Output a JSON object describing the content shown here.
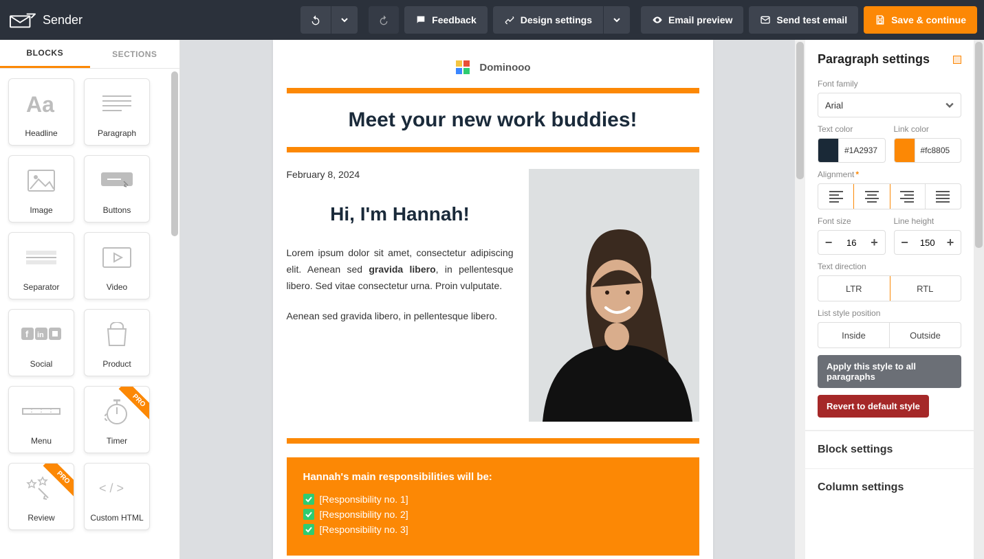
{
  "app": {
    "name": "Sender"
  },
  "topbar": {
    "feedback": "Feedback",
    "design_settings": "Design settings",
    "email_preview": "Email preview",
    "send_test": "Send test email",
    "save": "Save & continue"
  },
  "sidebar_tabs": {
    "blocks": "BLOCKS",
    "sections": "SECTIONS"
  },
  "blocks": [
    {
      "label": "Headline",
      "icon": "headline"
    },
    {
      "label": "Paragraph",
      "icon": "paragraph"
    },
    {
      "label": "Image",
      "icon": "image"
    },
    {
      "label": "Buttons",
      "icon": "buttons"
    },
    {
      "label": "Separator",
      "icon": "separator"
    },
    {
      "label": "Video",
      "icon": "video"
    },
    {
      "label": "Social",
      "icon": "social"
    },
    {
      "label": "Product",
      "icon": "product"
    },
    {
      "label": "Menu",
      "icon": "menu"
    },
    {
      "label": "Timer",
      "icon": "timer",
      "pro": true
    },
    {
      "label": "Review",
      "icon": "review",
      "pro": true
    },
    {
      "label": "Custom HTML",
      "icon": "html"
    }
  ],
  "email": {
    "brand": "Dominooo",
    "title": "Meet your new work buddies!",
    "date": "February 8, 2024",
    "greeting": "Hi, I'm Hannah!",
    "p1a": "Lorem ipsum dolor sit amet, consectetur adipiscing elit. Aenean sed ",
    "p1b": "gravida libero",
    "p1c": ", in pellentesque libero. Sed vitae consectetur urna. Proin vulputate.",
    "p2": "Aenean sed gravida libero, in pellentesque libero.",
    "resp_title": "Hannah's main responsibilities will be:",
    "responsibilities": [
      "[Responsibility no. 1]",
      "[Responsibility no. 2]",
      "[Responsibility no. 3]"
    ]
  },
  "settings": {
    "panel_title": "Paragraph settings",
    "font_family_label": "Font family",
    "font_family": "Arial",
    "text_color_label": "Text color",
    "text_color": "#1A2937",
    "link_color_label": "Link color",
    "link_color": "#fc8805",
    "alignment_label": "Alignment",
    "font_size_label": "Font size",
    "font_size": "16",
    "line_height_label": "Line height",
    "line_height": "150",
    "text_direction_label": "Text direction",
    "ltr": "LTR",
    "rtl": "RTL",
    "list_pos_label": "List style position",
    "inside": "Inside",
    "outside": "Outside",
    "apply_all": "Apply this style to all paragraphs",
    "revert": "Revert to default style",
    "block_settings": "Block settings",
    "column_settings": "Column settings"
  },
  "pro_label": "PRO"
}
